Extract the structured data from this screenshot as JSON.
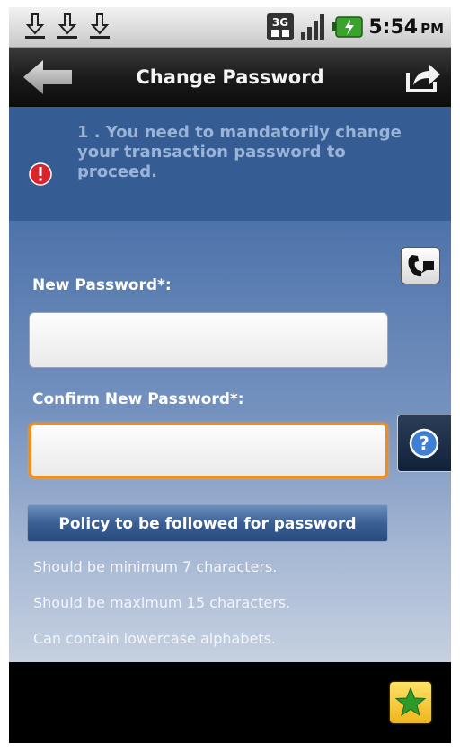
{
  "status_bar": {
    "network": "3G",
    "time": "5:54",
    "ampm": "PM",
    "download_icons": [
      "download-icon",
      "download-icon",
      "download-icon"
    ]
  },
  "title_bar": {
    "title": "Change Password"
  },
  "alert": {
    "message": "1 . You need to mandatorily change\nyour transaction password to\nproceed."
  },
  "form": {
    "new_password_label": "New Password*:",
    "new_password_value": "",
    "confirm_password_label": "Confirm New Password*:",
    "confirm_password_value": ""
  },
  "policy": {
    "header": "Policy to be followed for password",
    "items": [
      "Should be minimum 7 characters.",
      "Should be maximum 15 characters.",
      "Can contain lowercase alphabets."
    ]
  },
  "colors": {
    "accent_focus": "#f08c1c",
    "content_blue": "#395f96",
    "alert_red": "#d9262c",
    "favorite_yellow": "#f0b51d",
    "favorite_star": "#2e9a2a"
  }
}
